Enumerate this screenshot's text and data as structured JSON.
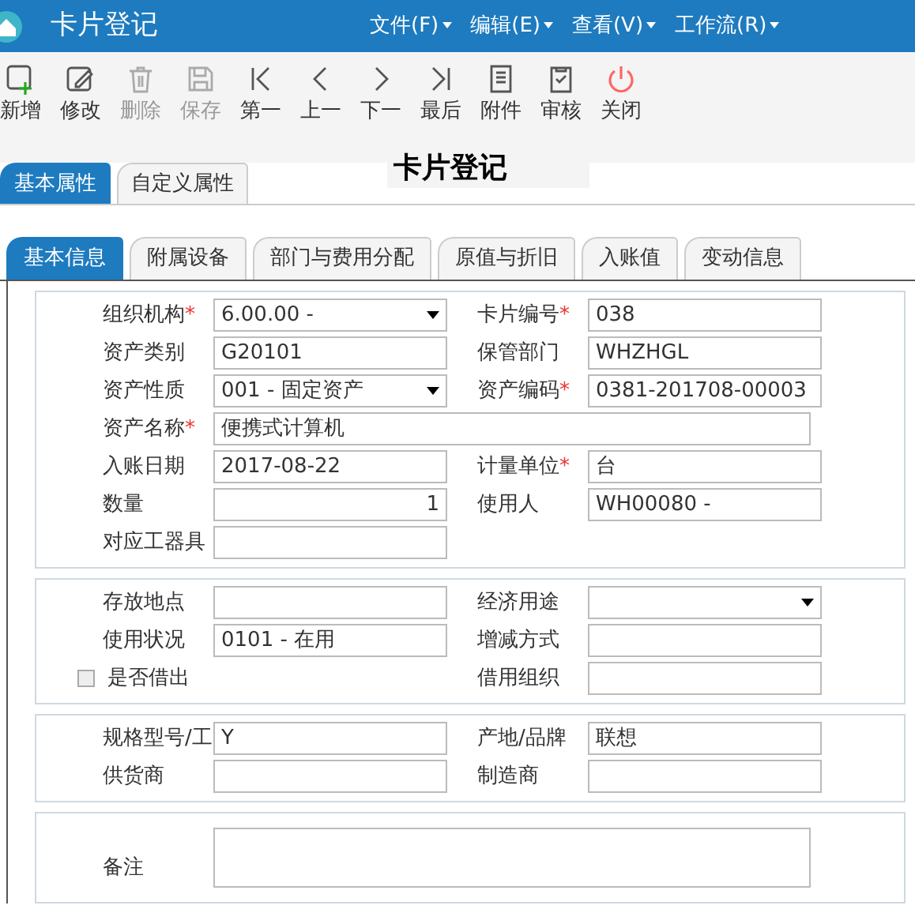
{
  "window": {
    "title": "卡片登记"
  },
  "menu": [
    {
      "label": "文件(F)"
    },
    {
      "label": "编辑(E)"
    },
    {
      "label": "查看(V)"
    },
    {
      "label": "工作流(R)"
    }
  ],
  "toolbar": [
    {
      "kind": "new",
      "label": "新增",
      "disabled": false
    },
    {
      "kind": "edit",
      "label": "修改",
      "disabled": false
    },
    {
      "kind": "delete",
      "label": "删除",
      "disabled": true
    },
    {
      "kind": "save",
      "label": "保存",
      "disabled": true
    },
    {
      "kind": "first",
      "label": "第一",
      "disabled": false
    },
    {
      "kind": "prev",
      "label": "上一",
      "disabled": false
    },
    {
      "kind": "next",
      "label": "下一",
      "disabled": false
    },
    {
      "kind": "last",
      "label": "最后",
      "disabled": false
    },
    {
      "kind": "attach",
      "label": "附件",
      "disabled": false
    },
    {
      "kind": "audit",
      "label": "审核",
      "disabled": false
    },
    {
      "kind": "close",
      "label": "关闭",
      "disabled": false
    }
  ],
  "outer_tabs": [
    {
      "label": "基本属性",
      "selected": true
    },
    {
      "label": "自定义属性",
      "selected": false
    }
  ],
  "form_title": "卡片登记",
  "inner_tabs": [
    {
      "label": "基本信息",
      "selected": true
    },
    {
      "label": "附属设备",
      "selected": false
    },
    {
      "label": "部门与费用分配",
      "selected": false
    },
    {
      "label": "原值与折旧",
      "selected": false
    },
    {
      "label": "入账值",
      "selected": false
    },
    {
      "label": "变动信息",
      "selected": false
    }
  ],
  "sections": [
    {
      "rows": [
        [
          {
            "label": "组织机构",
            "mark": "*",
            "kind": "select",
            "value": "6.00.00 -"
          },
          {
            "label": "卡片编号",
            "mark": "*",
            "kind": "text",
            "value": "038"
          }
        ],
        [
          {
            "label": "资产类别",
            "kind": "text",
            "value": "G20101"
          },
          {
            "label": "保管部门",
            "kind": "text",
            "value": "WHZHGL"
          }
        ],
        [
          {
            "label": "资产性质",
            "kind": "select",
            "value": "001 - 固定资产"
          },
          {
            "label": "资产编码",
            "mark": "*",
            "kind": "text",
            "value": "0381-201708-00003"
          }
        ],
        [
          {
            "label": "资产名称",
            "mark": "*",
            "kind": "wide",
            "value": "便携式计算机"
          }
        ],
        [
          {
            "label": "入账日期",
            "kind": "text",
            "value": "2017-08-22"
          },
          {
            "label": "计量单位",
            "mark": "*",
            "kind": "text",
            "value": "台"
          }
        ],
        [
          {
            "label": "数量",
            "kind": "number",
            "value": "1"
          },
          {
            "label": "使用人",
            "kind": "text",
            "value": "WH00080 -"
          }
        ],
        [
          {
            "label": "对应工器具",
            "kind": "text"
          }
        ]
      ]
    },
    {
      "rows": [
        [
          {
            "label": "存放地点",
            "kind": "text"
          },
          {
            "label": "经济用途",
            "kind": "select"
          }
        ],
        [
          {
            "label": "使用状况",
            "kind": "text",
            "value": "0101 - 在用"
          },
          {
            "label": "增减方式",
            "kind": "text"
          }
        ],
        [
          {
            "label": "是否借出",
            "kind": "checkbox",
            "checked": false
          },
          {
            "label": "借用组织",
            "kind": "text"
          }
        ]
      ]
    },
    {
      "rows": [
        [
          {
            "label": "规格型号/工",
            "kind": "text",
            "value": "Y"
          },
          {
            "label": "产地/品牌",
            "kind": "text",
            "value": "联想"
          }
        ],
        [
          {
            "label": "供货商",
            "kind": "text"
          },
          {
            "label": "制造商",
            "kind": "text"
          }
        ]
      ]
    },
    {
      "rows": [
        [
          {
            "label": "备注",
            "kind": "textarea"
          }
        ]
      ]
    }
  ]
}
